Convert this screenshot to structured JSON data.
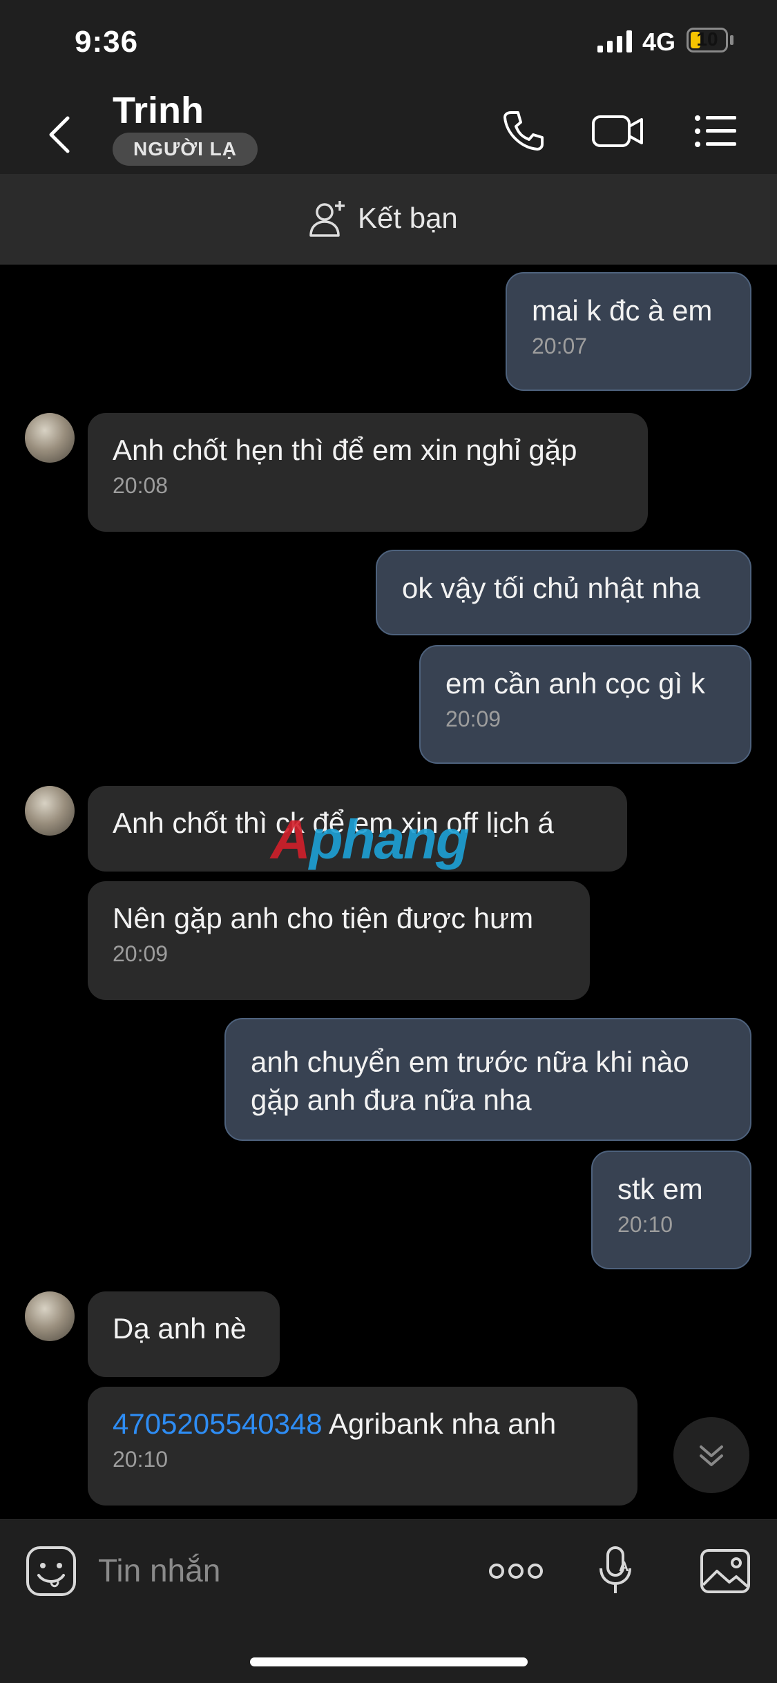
{
  "status_bar": {
    "time": "9:36",
    "network": "4G",
    "battery": "10"
  },
  "header": {
    "contact_name": "Trinh",
    "badge": "NGƯỜI LẠ"
  },
  "add_friend": {
    "label": "Kết bạn"
  },
  "messages": [
    {
      "dir": "out",
      "text": "mai k đc à em",
      "time": "20:07"
    },
    {
      "dir": "in",
      "text": "Anh chốt hẹn thì để em xin nghỉ gặp",
      "time": "20:08"
    },
    {
      "dir": "out",
      "text": "ok vậy tối chủ nhật nha"
    },
    {
      "dir": "out",
      "text": "em cần anh cọc gì k",
      "time": "20:09"
    },
    {
      "dir": "in",
      "text": "Anh chốt thì ck để em xin off lịch á"
    },
    {
      "dir": "in",
      "text": "Nên gặp anh cho tiện được hưm",
      "time": "20:09"
    },
    {
      "dir": "out",
      "text": "anh chuyển em trước nữa khi nào gặp anh đưa nữa nha"
    },
    {
      "dir": "out",
      "text": "stk em",
      "time": "20:10"
    },
    {
      "dir": "in",
      "text": "Dạ anh nè"
    },
    {
      "dir": "in",
      "link": "4705205540348",
      "text": " Agribank nha anh",
      "time": "20:10"
    }
  ],
  "watermark": {
    "part1": "A",
    "part2": "phang"
  },
  "input": {
    "placeholder": "Tin nhắn"
  },
  "icons": [
    "back-icon",
    "phone-icon",
    "video-icon",
    "menu-icon",
    "add-friend-icon",
    "scroll-down-icon",
    "sticker-icon",
    "more-icon",
    "voice-icon",
    "image-icon"
  ],
  "colors": {
    "outgoing_bubble": "#384252",
    "incoming_bubble": "#2a2a2a",
    "link": "#2e8df4",
    "battery": "#f5c400"
  }
}
